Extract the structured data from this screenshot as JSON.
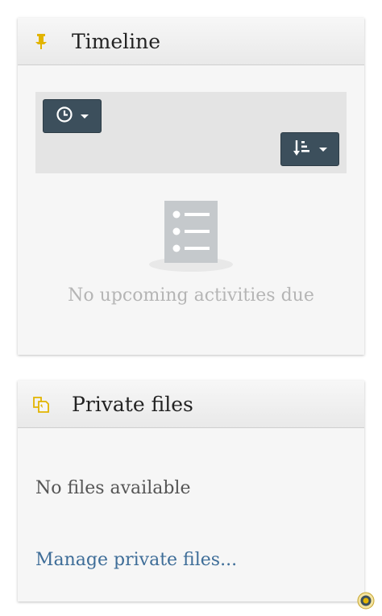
{
  "timeline": {
    "title": "Timeline",
    "empty_message": "No upcoming activities due"
  },
  "private_files": {
    "title": "Private files",
    "empty_message": "No files available",
    "manage_link": "Manage private files..."
  },
  "colors": {
    "accent": "#e2b400",
    "button": "#3c4f5c",
    "link": "#3e6d98"
  },
  "icons": {
    "timeline": "pin-icon",
    "private_files": "files-icon",
    "time_filter": "clock-icon",
    "sort": "sort-icon"
  }
}
